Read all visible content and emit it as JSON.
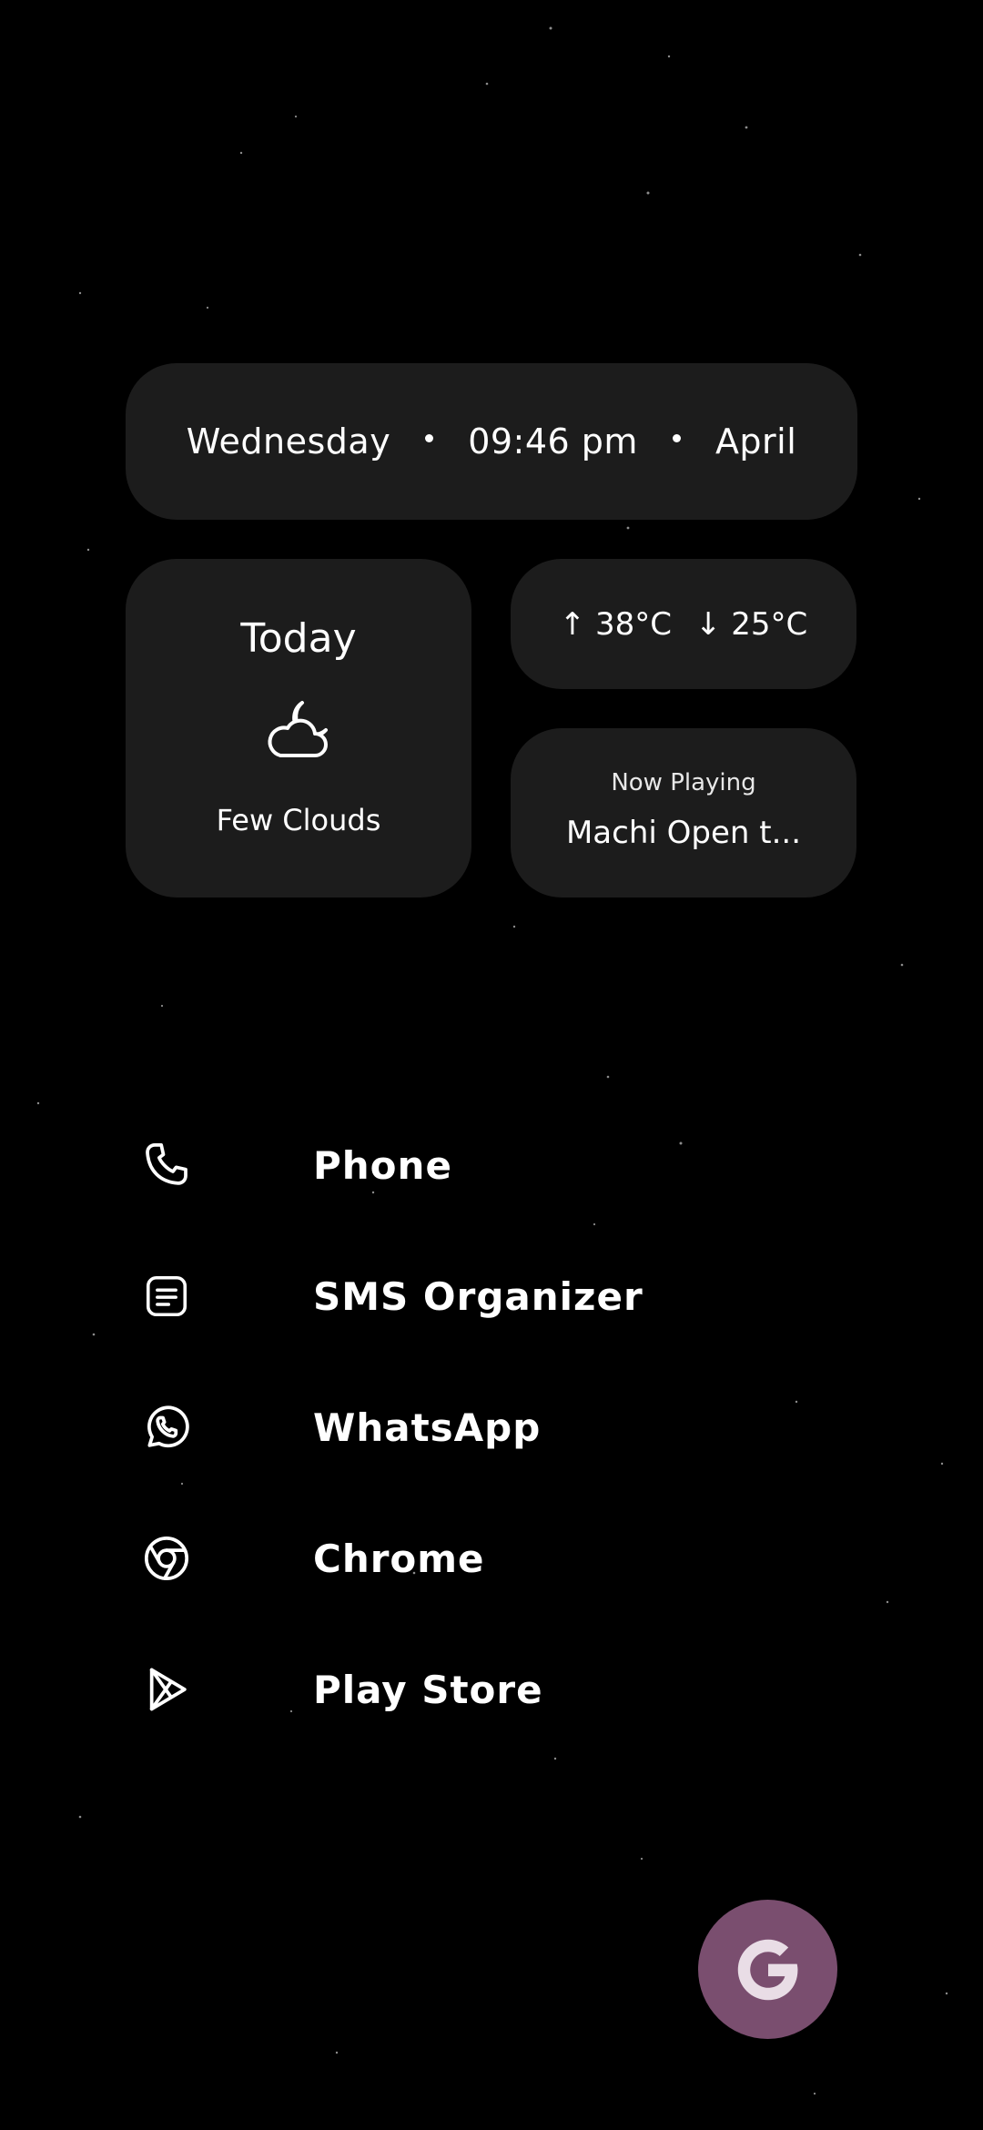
{
  "header_widget": {
    "day": "Wednesday",
    "time": "09:46 pm",
    "month": "April"
  },
  "weather": {
    "title": "Today",
    "condition": "Few Clouds",
    "icon": "cloud-moon-icon",
    "high": "↑ 38°C",
    "low": "↓ 25°C"
  },
  "music": {
    "label": "Now Playing",
    "track": "Machi Open t..."
  },
  "apps": [
    {
      "label": "Phone",
      "icon": "phone-icon"
    },
    {
      "label": "SMS Organizer",
      "icon": "message-icon"
    },
    {
      "label": "WhatsApp",
      "icon": "whatsapp-icon"
    },
    {
      "label": "Chrome",
      "icon": "chrome-icon"
    },
    {
      "label": "Play Store",
      "icon": "play-store-icon"
    }
  ],
  "google_button": {
    "letter": "G",
    "icon": "google-icon"
  },
  "colors": {
    "background": "#000000",
    "card": "#1c1c1c",
    "text": "#ffffff",
    "google_fab": "#7a4e6f"
  }
}
